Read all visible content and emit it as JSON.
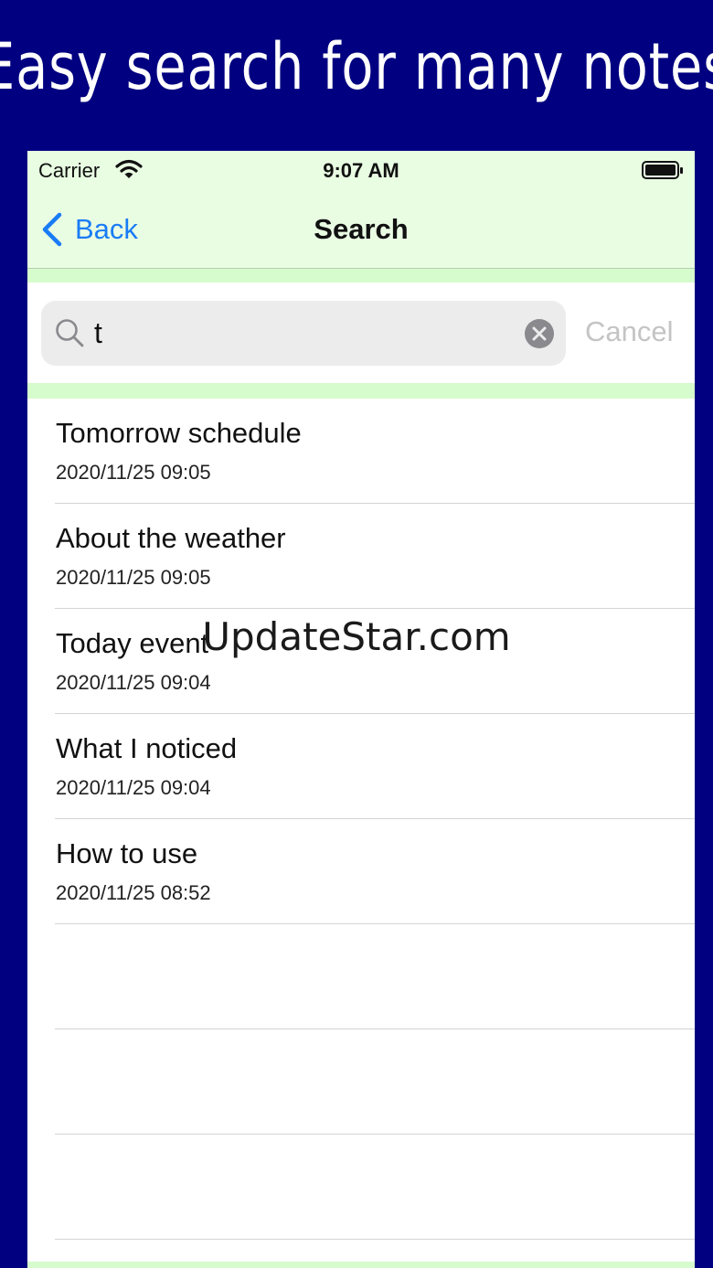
{
  "banner": {
    "text": "Easy search for many notes"
  },
  "status_bar": {
    "carrier": "Carrier",
    "time": "9:07 AM"
  },
  "nav": {
    "back_label": "Back",
    "title": "Search"
  },
  "search": {
    "value": "t",
    "cancel_label": "Cancel"
  },
  "results": [
    {
      "title": "Tomorrow schedule",
      "date": "2020/11/25 09:05"
    },
    {
      "title": "About the weather",
      "date": "2020/11/25 09:05"
    },
    {
      "title": "Today event",
      "date": "2020/11/25 09:04"
    },
    {
      "title": "What I noticed",
      "date": "2020/11/25 09:04"
    },
    {
      "title": "How to use",
      "date": "2020/11/25 08:52"
    }
  ],
  "watermark": "UpdateStar.com",
  "colors": {
    "frame": "#000080",
    "bar_background": "#e9fde3",
    "accent_strip": "#d6fbcc",
    "link": "#1a7cf5"
  }
}
